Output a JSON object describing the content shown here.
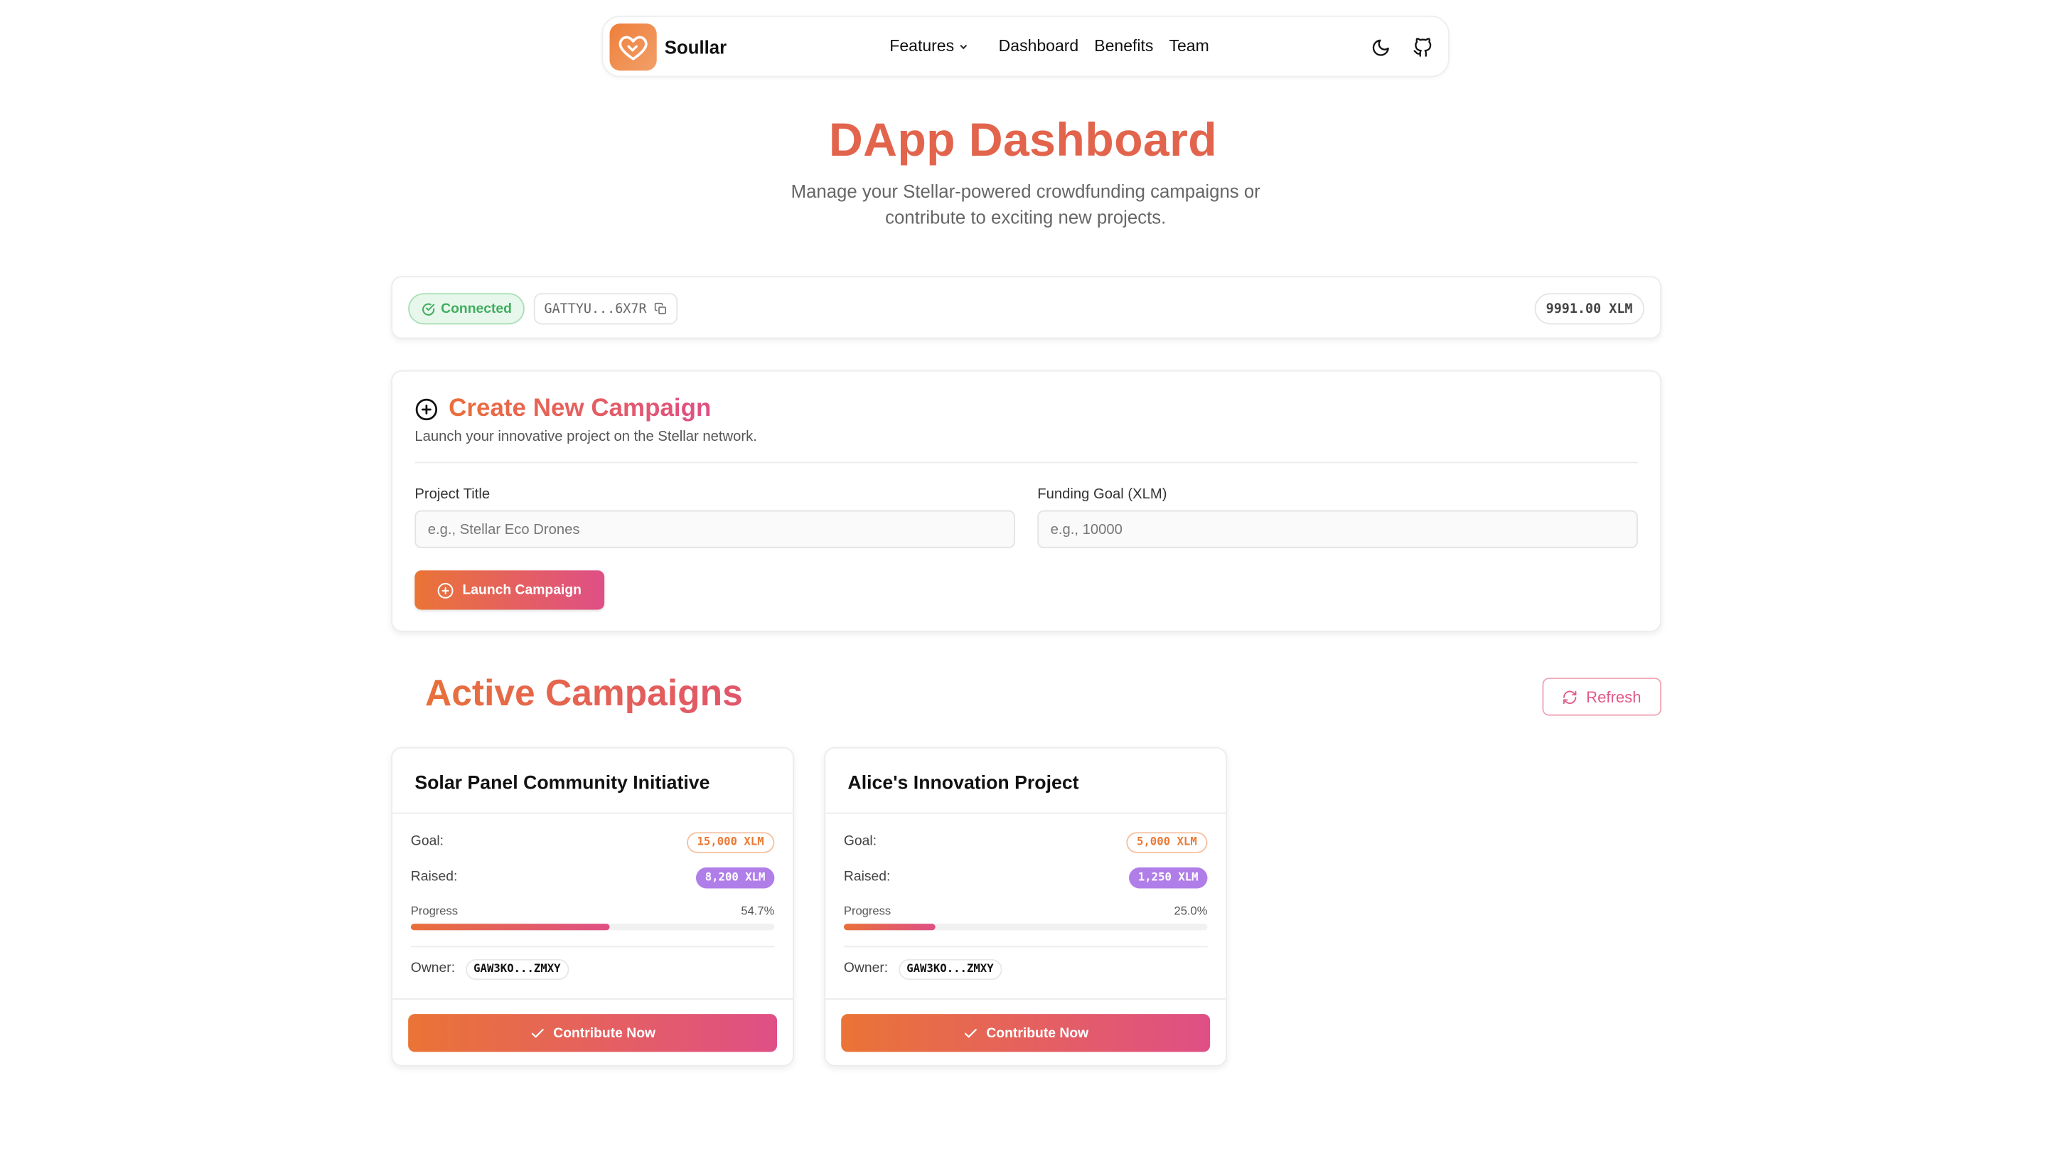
{
  "nav": {
    "brand": "Soullar",
    "links": [
      "Features",
      "Dashboard",
      "Benefits",
      "Team"
    ],
    "icons": [
      "moon-icon",
      "github-icon"
    ]
  },
  "hero": {
    "title": "DApp Dashboard",
    "subtitle": "Manage your Stellar-powered crowdfunding campaigns or contribute to exciting new projects."
  },
  "wallet": {
    "status": "Connected",
    "address": "GATTYU...6X7R",
    "balance": "9991.00 XLM"
  },
  "create": {
    "title": "Create New Campaign",
    "description": "Launch your innovative project on the Stellar network.",
    "project_title_label": "Project Title",
    "project_title_placeholder": "e.g., Stellar Eco Drones",
    "goal_label": "Funding Goal (XLM)",
    "goal_placeholder": "e.g., 10000",
    "launch_label": "Launch Campaign"
  },
  "campaigns_section": {
    "title": "Active Campaigns",
    "refresh_label": "Refresh"
  },
  "campaigns": [
    {
      "title": "Solar Panel Community Initiative",
      "goal_label": "Goal:",
      "goal": "15,000 XLM",
      "raised_label": "Raised:",
      "raised": "8,200 XLM",
      "progress_label": "Progress",
      "progress_text": "54.7%",
      "progress_fraction": 0.547,
      "owner_label": "Owner:",
      "owner": "GAW3KO...ZMXY",
      "cta": "Contribute Now"
    },
    {
      "title": "Alice's Innovation Project",
      "goal_label": "Goal:",
      "goal": "5,000 XLM",
      "raised_label": "Raised:",
      "raised": "1,250 XLM",
      "progress_label": "Progress",
      "progress_text": "25.0%",
      "progress_fraction": 0.25,
      "owner_label": "Owner:",
      "owner": "GAW3KO...ZMXY",
      "cta": "Contribute Now"
    }
  ],
  "colors": {
    "accent_orange": "#ea7436",
    "accent_pink": "#df4f86",
    "hero_title": "#e2644c",
    "raised_purple": "#b07ee8",
    "connected_green": "#3fae5e"
  }
}
